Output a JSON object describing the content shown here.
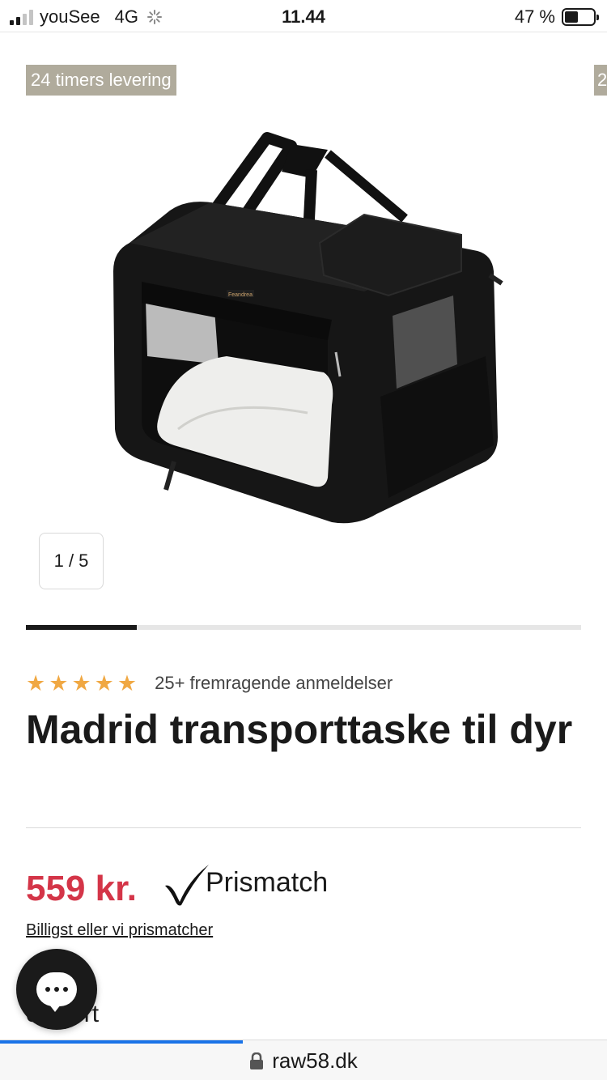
{
  "status_bar": {
    "carrier": "youSee",
    "network": "4G",
    "time": "11.44",
    "battery_percent": "47 %",
    "battery_level": 0.47
  },
  "gallery": {
    "badge_text": "24 timers levering",
    "badge_peek_text": "2",
    "counter": "1 / 5",
    "progress": 0.2
  },
  "product": {
    "rating_stars": 5,
    "review_text": "25+ fremragende anmeldelser",
    "title": "Madrid transporttaske til dyr",
    "brand_logo_text": "Feandrea",
    "price": "559 kr.",
    "prismatch_label": "Prismatch",
    "price_match_link": "Billigst eller vi prismatcher",
    "color_label_partial": "e:",
    "color_value": "Sort"
  },
  "browser": {
    "url": "raw58.dk"
  },
  "colors": {
    "accent_price": "#d43548",
    "star": "#f0a843",
    "badge_bg": "#b0ab9c",
    "browser_progress": "#1a73e8"
  },
  "icons": [
    "signal-icon",
    "loading-icon",
    "battery-icon",
    "star-icon",
    "checkmark-icon",
    "chat-icon",
    "lock-icon"
  ]
}
